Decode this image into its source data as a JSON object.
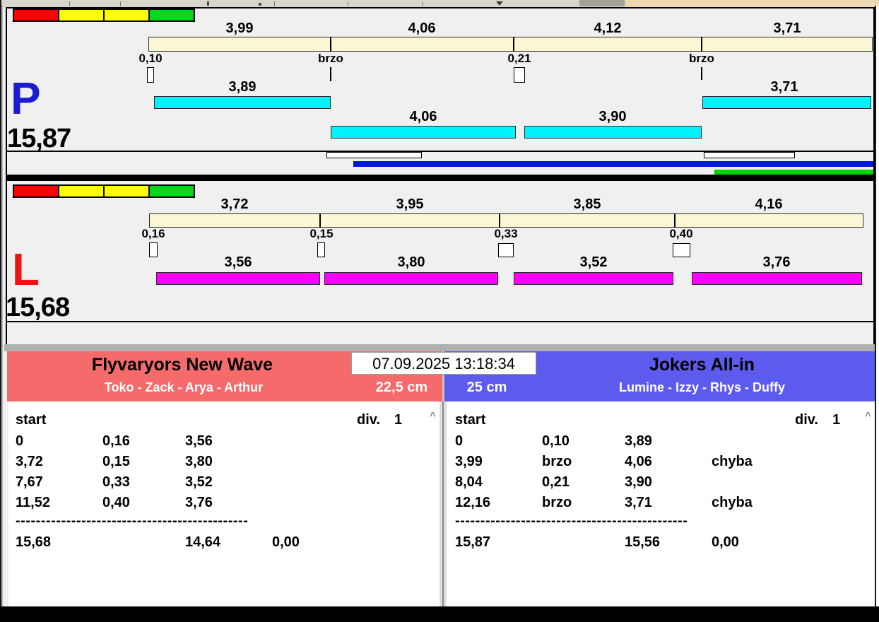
{
  "window": {
    "timestamp": "07.09.2025 13:18:34"
  },
  "lanes": {
    "status_lights": [
      "#ff0000",
      "#ffff00",
      "#ffff00",
      "#00d81c"
    ],
    "p": {
      "letter": "P",
      "letter_color": "#1b1bd0",
      "total": "15,87",
      "splits": [
        "3,99",
        "4,06",
        "4,12",
        "3,71"
      ],
      "crossings": [
        "0,10",
        "brzo",
        "0,21",
        "brzo"
      ],
      "runs": [
        "3,89",
        "4,06",
        "3,90",
        "3,71"
      ],
      "run_bar_color": "#00f2fa",
      "segment_bar_color": "#fbf7d5",
      "progress_blue": "#0019d2",
      "progress_green": "#00d400"
    },
    "l": {
      "letter": "L",
      "letter_color": "#ea1515",
      "total": "15,68",
      "splits": [
        "3,72",
        "3,95",
        "3,85",
        "4,16"
      ],
      "crossings": [
        "0,16",
        "0,15",
        "0,33",
        "0,40"
      ],
      "runs": [
        "3,56",
        "3,80",
        "3,52",
        "3,76"
      ],
      "run_bar_color": "#ff00ff",
      "segment_bar_color": "#fbf7d5"
    }
  },
  "teams": {
    "left": {
      "name": "Flyvaryors New Wave",
      "members": "Toko - Zack - Arya - Arthur",
      "jump_height": "22,5 cm",
      "color": "#f56a6a",
      "table": {
        "start_label": "start",
        "div_label": "div.",
        "div_value": "1",
        "rows": [
          [
            "0",
            "0,16",
            "3,56",
            ""
          ],
          [
            "3,72",
            "0,15",
            "3,80",
            ""
          ],
          [
            "7,67",
            "0,33",
            "3,52",
            ""
          ],
          [
            "11,52",
            "0,40",
            "3,76",
            ""
          ]
        ],
        "separator": "----------------------------------------------",
        "total_time": "15,68",
        "total_clean": "14,64",
        "total_penalty": "0,00"
      }
    },
    "right": {
      "name": "Jokers All-in",
      "members": "Lumine - Izzy - Rhys - Duffy",
      "jump_height": "25 cm",
      "color": "#5d5bee",
      "table": {
        "start_label": "start",
        "div_label": "div.",
        "div_value": "1",
        "rows": [
          [
            "0",
            "0,10",
            "3,89",
            ""
          ],
          [
            "3,99",
            "brzo",
            "4,06",
            "chyba"
          ],
          [
            "8,04",
            "0,21",
            "3,90",
            ""
          ],
          [
            "12,16",
            "brzo",
            "3,71",
            "chyba"
          ]
        ],
        "separator": "----------------------------------------------",
        "total_time": "15,87",
        "total_clean": "15,56",
        "total_penalty": "0,00"
      }
    }
  },
  "scrollbar": {
    "up_glyph": "^"
  }
}
